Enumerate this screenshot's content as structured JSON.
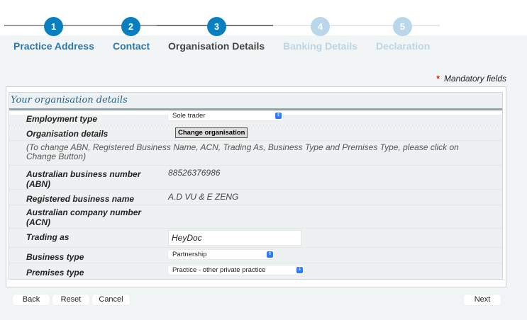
{
  "steps": [
    {
      "number": "1",
      "label": "Practice Address",
      "state": "done"
    },
    {
      "number": "2",
      "label": "Contact",
      "state": "done"
    },
    {
      "number": "3",
      "label": "Organisation Details",
      "state": "current"
    },
    {
      "number": "4",
      "label": "Banking Details",
      "state": "todo"
    },
    {
      "number": "5",
      "label": "Declaration",
      "state": "todo"
    }
  ],
  "mandatory": {
    "star": "*",
    "text": "Mandatory fields"
  },
  "panel": {
    "title": "Your organisation details",
    "employment_type": {
      "label": "Employment type",
      "value": "Sole trader"
    },
    "organisation_details": {
      "label": "Organisation details",
      "button": "Change organisation"
    },
    "note": "(To change ABN, Registered Business Name, ACN, Trading As, Business Type and Premises Type, please click on Change Button)",
    "abn": {
      "label": "Australian business number (ABN)",
      "value": "88526376986"
    },
    "registered_name": {
      "label": "Registered business name",
      "value": "A.D VU & E ZENG"
    },
    "acn": {
      "label": "Australian company number (ACN)",
      "value": ""
    },
    "trading_as": {
      "label": "Trading as",
      "value": "HeyDoc"
    },
    "business_type": {
      "label": "Business type",
      "value": "Partnership"
    },
    "premises_type": {
      "label": "Premises type",
      "value": "Practice - other private practice"
    }
  },
  "buttons": {
    "back": "Back",
    "reset": "Reset",
    "cancel": "Cancel",
    "next": "Next"
  },
  "colors": {
    "accent": "#0a7fc0",
    "pending": "#b9d6ea"
  }
}
